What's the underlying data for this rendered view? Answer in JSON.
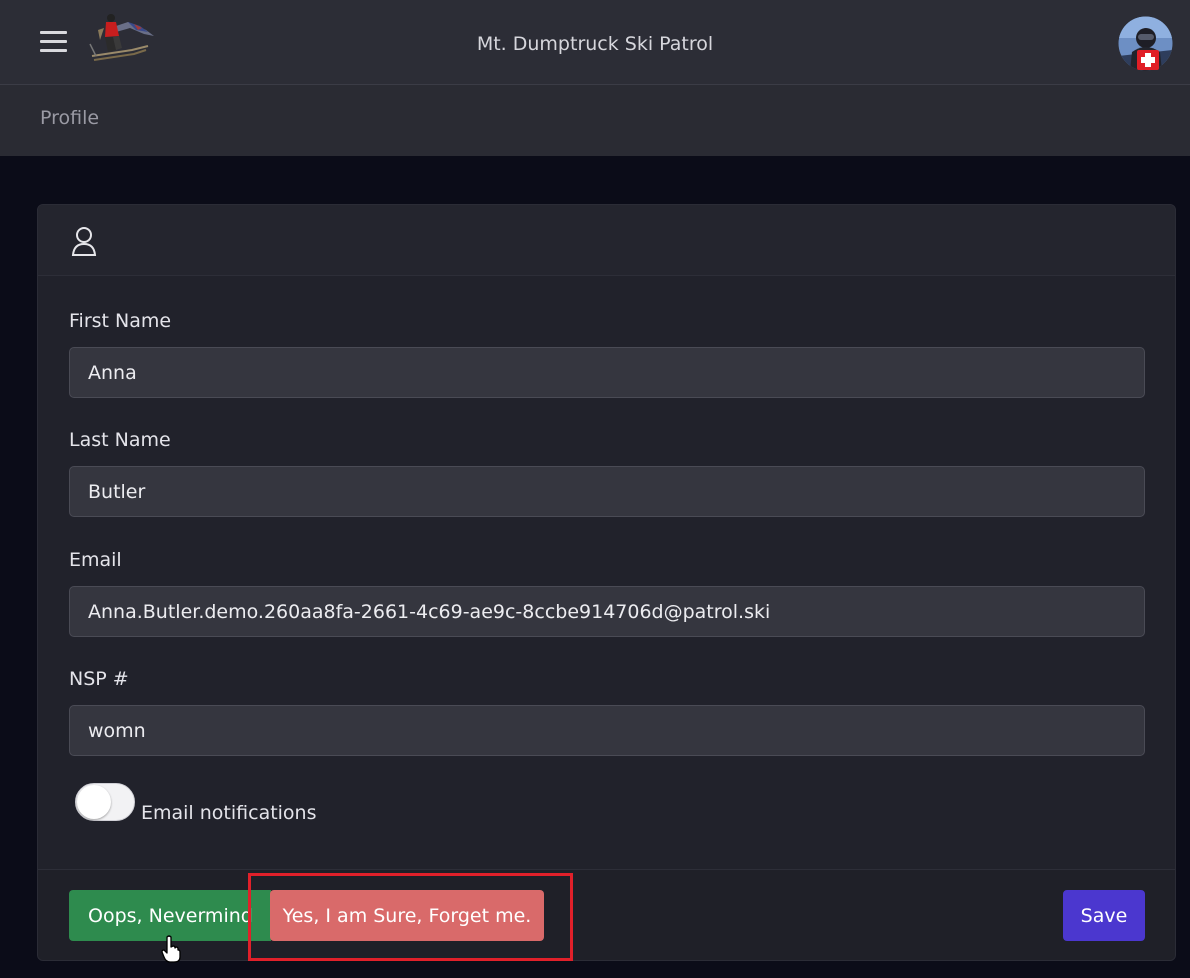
{
  "header": {
    "app_title": "Mt. Dumptruck Ski Patrol",
    "menu_icon": "hamburger-menu-icon",
    "logo": "ski-patrol-logo",
    "avatar": "user-avatar"
  },
  "breadcrumb": {
    "current": "Profile"
  },
  "card": {
    "header_icon": "user-icon",
    "fields": [
      {
        "label": "First Name",
        "value": "Anna"
      },
      {
        "label": "Last Name",
        "value": "Butler"
      },
      {
        "label": "Email",
        "value": "Anna.Butler.demo.260aa8fa-2661-4c69-ae9c-8ccbe914706d@patrol.ski"
      },
      {
        "label": "NSP #",
        "value": "womn"
      }
    ],
    "email_notifications": {
      "label": "Email notifications",
      "enabled": false
    }
  },
  "footer": {
    "nevermind_label": "Oops, Nevermind",
    "forget_label": "Yes, I am Sure, Forget me.",
    "save_label": "Save"
  },
  "colors": {
    "topbar": "#2c2d36",
    "background": "#0b0c18",
    "nevermind": "#2e8b4e",
    "forget": "#d96a6a",
    "save": "#4b37cf",
    "highlight": "#e0202a"
  }
}
